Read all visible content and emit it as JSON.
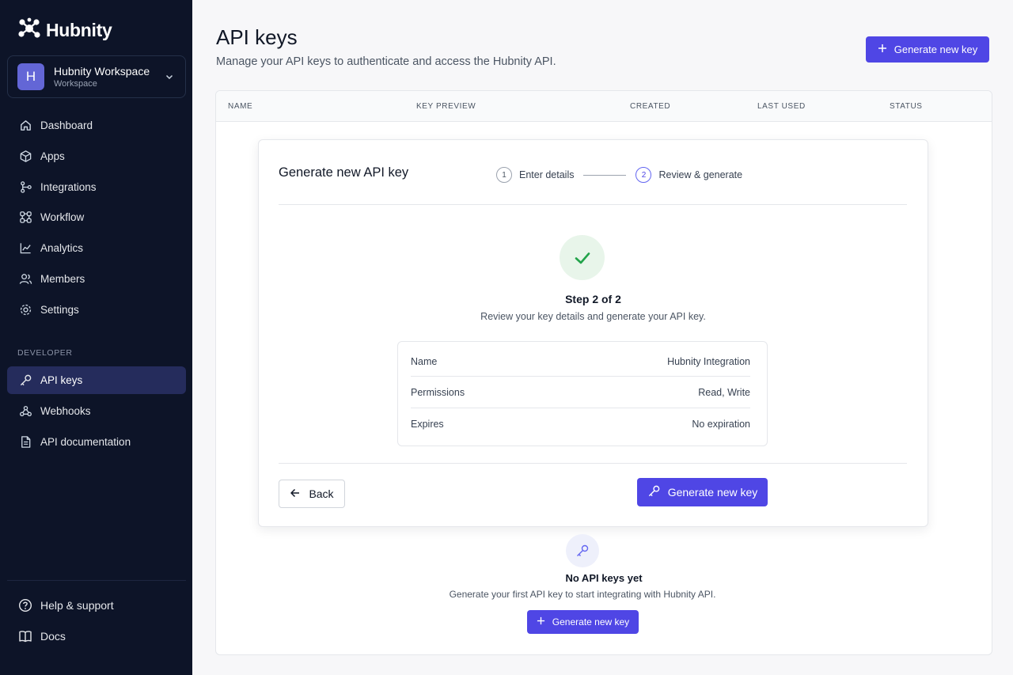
{
  "brand": {
    "name": "Hubnity",
    "accent": "#4f46e5"
  },
  "workspace": {
    "avatar": "H",
    "name": "Hubnity Workspace",
    "type": "Workspace"
  },
  "sidebar": {
    "items": [
      {
        "label": "Dashboard",
        "icon": "home-icon"
      },
      {
        "label": "Apps",
        "icon": "box-icon"
      },
      {
        "label": "Integrations",
        "icon": "integrations-icon"
      },
      {
        "label": "Workflow",
        "icon": "workflow-icon"
      },
      {
        "label": "Analytics",
        "icon": "chart-line-icon"
      },
      {
        "label": "Members",
        "icon": "users-icon"
      },
      {
        "label": "Settings",
        "icon": "gear-icon"
      }
    ],
    "developer_section": "DEVELOPER",
    "developer_items": [
      {
        "label": "API keys",
        "icon": "key-icon",
        "active": true
      },
      {
        "label": "Webhooks",
        "icon": "webhook-icon"
      },
      {
        "label": "API documentation",
        "icon": "document-icon"
      }
    ],
    "footer_items": [
      {
        "label": "Help & support",
        "icon": "help-icon"
      },
      {
        "label": "Docs",
        "icon": "book-icon"
      }
    ]
  },
  "header": {
    "title": "API keys",
    "subtitle": "Manage your API keys to authenticate and access the Hubnity API.",
    "primary_button": "Generate new key"
  },
  "table": {
    "columns": [
      "NAME",
      "KEY PREVIEW",
      "CREATED",
      "LAST USED",
      "STATUS"
    ]
  },
  "modal": {
    "title": "Generate new API key",
    "steps": [
      {
        "number": "1",
        "label": "Enter details"
      },
      {
        "number": "2",
        "label": "Review & generate"
      }
    ],
    "step_title": "Step 2 of 2",
    "step_description": "Review your key details and generate your API key.",
    "summary": [
      {
        "key": "Name",
        "value": "Hubnity Integration"
      },
      {
        "key": "Permissions",
        "value": "Read, Write"
      },
      {
        "key": "Expires",
        "value": "No expiration"
      }
    ],
    "back_button": "Back",
    "generate_button": "Generate new key"
  },
  "empty_state": {
    "title": "No API keys yet",
    "description": "Generate your first API key to start integrating with Hubnity API.",
    "button": "Generate new key"
  }
}
